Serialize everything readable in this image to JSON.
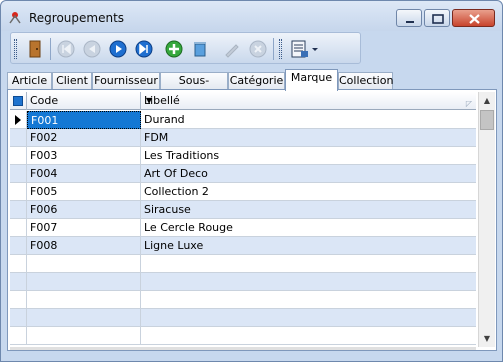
{
  "window": {
    "title": "Regroupements",
    "buttons": {
      "minimize": "minimize",
      "maximize": "maximize",
      "close": "close"
    }
  },
  "toolbar": {
    "icons": [
      "exit-door-icon",
      "first-record-icon",
      "previous-record-icon",
      "next-record-icon",
      "last-record-icon",
      "add-record-icon",
      "delete-record-icon",
      "edit-record-icon",
      "cancel-record-icon",
      "print-menu-icon"
    ]
  },
  "tabs": [
    {
      "label": "Article",
      "active": false
    },
    {
      "label": "Client",
      "active": false
    },
    {
      "label": "Fournisseur",
      "active": false
    },
    {
      "label": "Sous-famille",
      "active": false
    },
    {
      "label": "Catégorie",
      "active": false
    },
    {
      "label": "Marque",
      "active": true
    },
    {
      "label": "Collection",
      "active": false
    }
  ],
  "grid": {
    "columns": {
      "code": "Code",
      "libelle": "Libellé"
    },
    "rows": [
      {
        "code": "F001",
        "libelle": "Durand"
      },
      {
        "code": "F002",
        "libelle": "FDM"
      },
      {
        "code": "F003",
        "libelle": "Les Traditions"
      },
      {
        "code": "F004",
        "libelle": "Art Of Deco"
      },
      {
        "code": "F005",
        "libelle": "Collection 2"
      },
      {
        "code": "F006",
        "libelle": "Siracuse"
      },
      {
        "code": "F007",
        "libelle": "Le Cercle Rouge"
      },
      {
        "code": "F008",
        "libelle": "Ligne Luxe"
      },
      {
        "code": "",
        "libelle": ""
      },
      {
        "code": "",
        "libelle": ""
      },
      {
        "code": "",
        "libelle": ""
      },
      {
        "code": "",
        "libelle": ""
      },
      {
        "code": "",
        "libelle": ""
      }
    ],
    "current_row": 0
  },
  "colors": {
    "selection": "#1478d4",
    "alt_row": "#dbe6f6",
    "chrome": "#c7d8ee"
  }
}
